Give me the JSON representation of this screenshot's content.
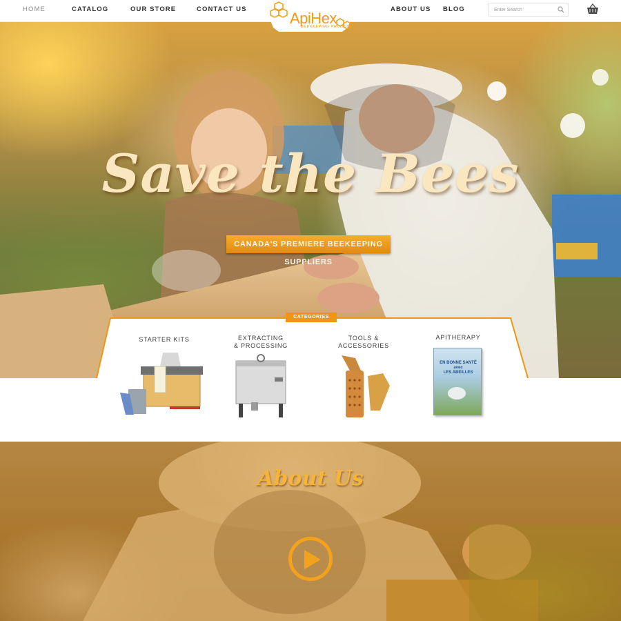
{
  "nav": {
    "items": [
      {
        "label": "HOME",
        "active": true
      },
      {
        "label": "CATALOG"
      },
      {
        "label": "OUR STORE"
      },
      {
        "label": "CONTACT US"
      },
      {
        "label": "ABOUT US"
      },
      {
        "label": "BLOG"
      }
    ],
    "search_placeholder": "Enter Search",
    "icons": {
      "search": "search-icon",
      "cart": "shopping-basket-icon"
    }
  },
  "logo": {
    "name": "ApiHex",
    "tagline": "BEEKEEPING PRODUCTS"
  },
  "hero": {
    "title": "Save the Bees",
    "ribbon": "CANADA'S PREMIERE BEEKEEPING SUPPLIERS"
  },
  "categories": {
    "tab_label": "CATEGORIES",
    "items": [
      {
        "label": "STARTER KITS"
      },
      {
        "label_line1": "EXTRACTING",
        "label_line2": "& PROCESSING"
      },
      {
        "label_line1": "TOOLS &",
        "label_line2": "ACCESSORIES"
      },
      {
        "label": "APITHERAPY",
        "book_text": [
          "EN BONNE SANTÉ",
          "avec",
          "LES ABEILLES"
        ]
      }
    ]
  },
  "about": {
    "title": "About Us",
    "play_icon": "play-icon"
  },
  "colors": {
    "accent": "#f09514",
    "ribbon": "#e38a10",
    "text": "#2f2f2f"
  }
}
